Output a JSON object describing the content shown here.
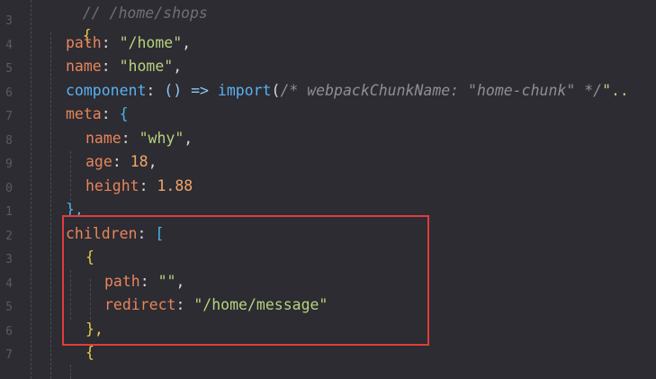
{
  "gutter": {
    "line_numbers": [
      "",
      "3",
      "4",
      "5",
      "6",
      "7",
      "8",
      "9",
      "0",
      "1",
      "2",
      "3",
      "4",
      "5",
      "6",
      "7"
    ]
  },
  "code": {
    "comment_top": "// /home/shops",
    "open_brace": "{",
    "path_key": "path",
    "path_value": "\"/home\"",
    "name_key": "name",
    "name_value": "\"home\"",
    "component_key": "component",
    "component_arrow": "() =>",
    "import_kw": "import",
    "import_paren": "(",
    "import_comment": "/* webpackChunkName: \"home-chunk\" */",
    "import_tail": "\"..",
    "meta_key": "meta",
    "meta_open": "{",
    "meta_name_key": "name",
    "meta_name_value": "\"why\"",
    "age_key": "age",
    "age_value": "18",
    "height_key": "height",
    "height_value": "1.88",
    "meta_close": "},",
    "children_key": "children",
    "children_open": "[",
    "child_open": "{",
    "child_path_key": "path",
    "child_path_value": "\"\"",
    "redirect_key": "redirect",
    "redirect_value": "\"/home/message\"",
    "child_close": "},",
    "child2_open": "{"
  },
  "colors": {
    "highlight_box": "#e23b3b",
    "background": "#2c2c32"
  }
}
